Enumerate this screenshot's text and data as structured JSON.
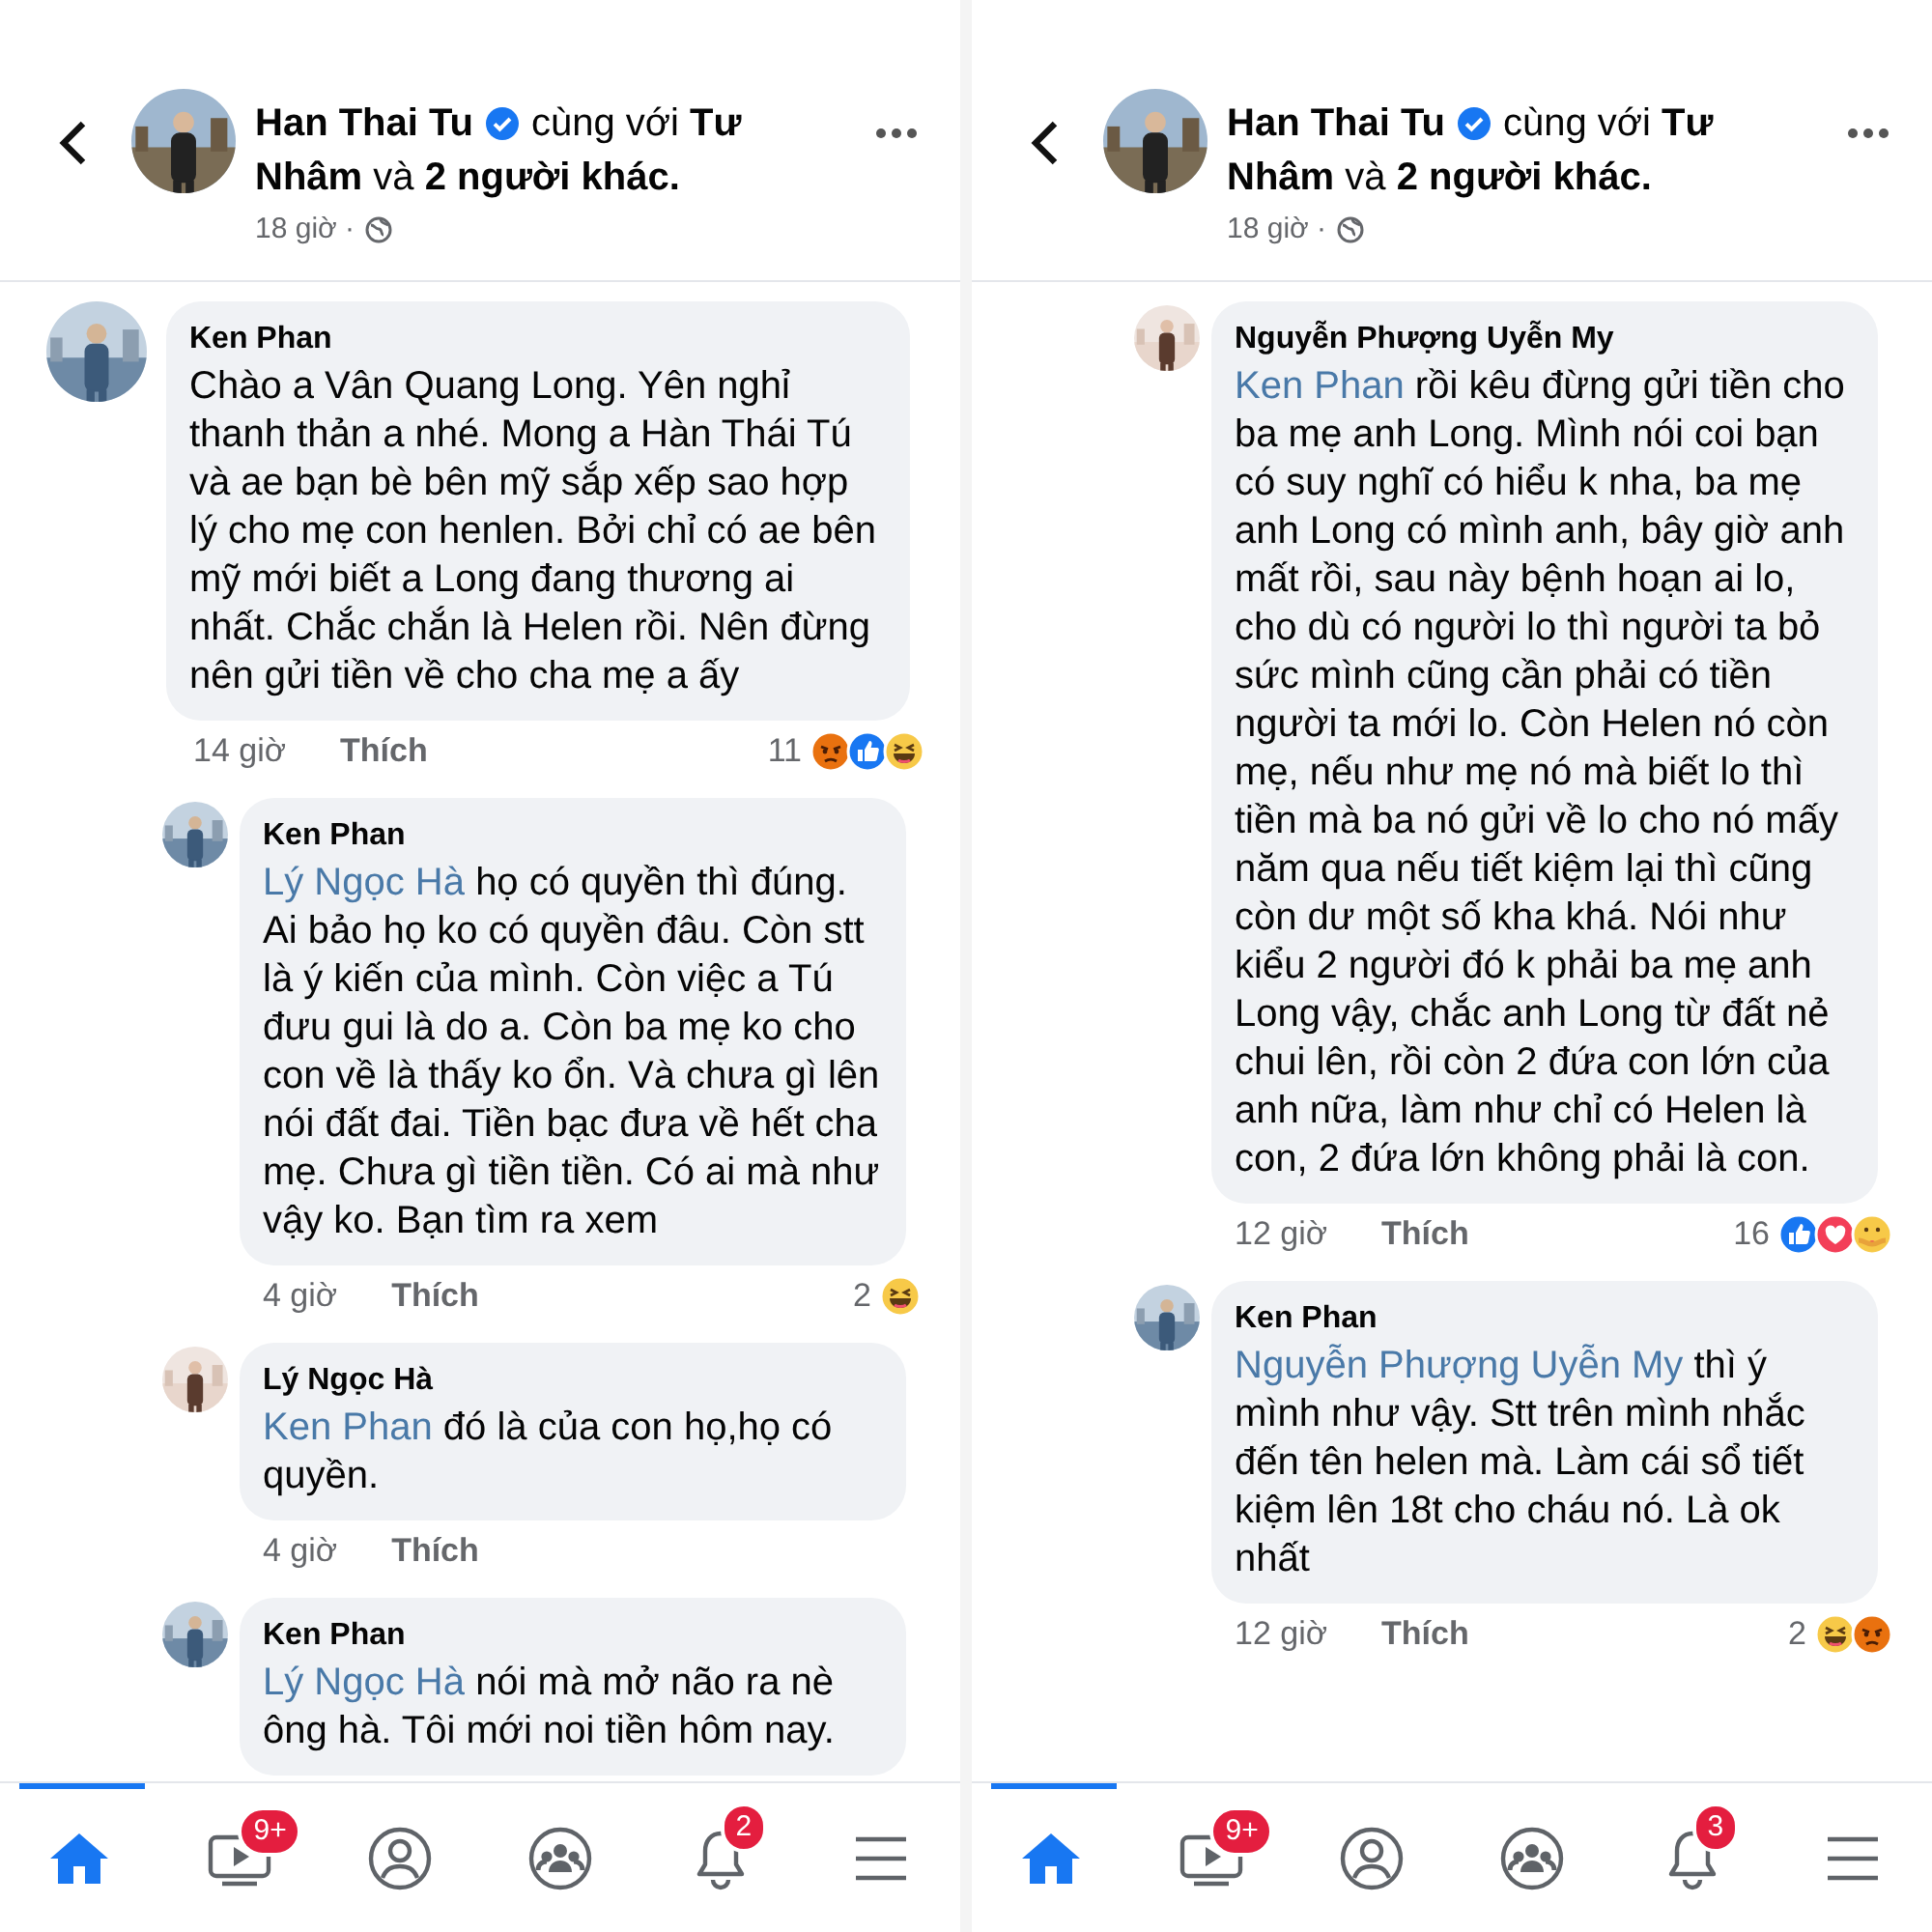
{
  "panels": [
    {
      "post": {
        "author": "Han Thai Tu",
        "verified": true,
        "with_lines": [
          "cùng với **Tư**",
          "**Nhâm** và **2 người khác.**"
        ],
        "time": "18 giờ ·"
      },
      "comments": [
        {
          "kind": "top",
          "author": "Ken Phan",
          "text": "Chào a Vân Quang Long. Yên nghỉ thanh thản a nhé. Mong a Hàn Thái Tú và ae bạn bè bên mỹ sắp xếp sao hợp lý cho mẹ con henlen. Bởi chỉ có ae bên mỹ mới biết a Long đang thương ai nhất. Chắc chắn là Helen rồi. Nên đừng nên gửi tiền về cho cha mẹ a ấy",
          "time": "14 giờ",
          "like": "Thích",
          "reactions": {
            "count": "11",
            "icons": [
              {
                "kind": "angry"
              },
              {
                "kind": "like"
              },
              {
                "kind": "haha"
              }
            ]
          }
        },
        {
          "kind": "reply",
          "author": "Ken Phan",
          "mention": "Lý Ngọc Hà",
          "text": "họ có quyền thì đúng. Ai bảo họ ko có quyền đâu. Còn stt là ý kiến của mình. Còn việc a Tú đưu gui là do a. Còn ba mẹ ko cho con về là thấy ko ổn. Và chưa gì lên nói đất đai. Tiền bạc đưa về hết cha mẹ. Chưa gì tiền tiền. Có ai mà như vậy ko. Bạn tìm ra xem",
          "time": "4 giờ",
          "like": "Thích",
          "reactions": {
            "count": "2",
            "icons": [
              {
                "kind": "haha"
              }
            ]
          }
        },
        {
          "kind": "reply",
          "author": "Lý Ngọc Hà",
          "mention": "Ken Phan",
          "text": " đó là của con họ,họ có quyền.",
          "time": "4 giờ",
          "like": "Thích"
        },
        {
          "kind": "reply",
          "author": "Ken Phan",
          "mention": "Lý Ngọc Hà",
          "text": "nói mà mở não ra nè ông hà. Tôi mới noi tiền hôm nay."
        }
      ],
      "nav": [
        {
          "kind": "home",
          "selected": true
        },
        {
          "kind": "watch",
          "badge": "9+",
          "selected": false
        },
        {
          "kind": "profile",
          "selected": false
        },
        {
          "kind": "groups",
          "selected": false
        },
        {
          "kind": "bell",
          "badge": "2",
          "selected": false
        },
        {
          "kind": "menu",
          "selected": false
        }
      ]
    },
    {
      "post": {
        "author": "Han Thai Tu",
        "verified": true,
        "with_lines": [
          "cùng với **Tư**",
          "**Nhâm** và **2 người khác.**"
        ],
        "time": "18 giờ ·"
      },
      "comments": [
        {
          "kind": "reply",
          "author": "Nguyễn Phượng Uyễn My",
          "mention": "Ken Phan",
          "text": "rồi kêu đừng gửi tiền cho ba mẹ anh Long. Mình nói coi bạn có suy nghĩ có hiểu k nha, ba mẹ anh Long có mình anh, bây giờ anh mất rồi, sau này bệnh hoạn ai lo, cho dù có người lo thì người ta bỏ sức mình cũng cần phải có tiền người ta mới lo. Còn Helen nó còn mẹ, nếu như mẹ nó mà biết lo thì tiền mà ba nó gửi về lo cho nó mấy năm qua nếu tiết kiệm lại thì cũng còn dư một số kha khá. Nói như kiểu 2 người đó k phải ba mẹ anh Long vậy, chắc anh Long từ đất nẻ chui lên, rồi còn 2 đứa con lớn của anh nữa, làm như chỉ có Helen là con, 2 đứa lớn không phải là con.",
          "time": "12 giờ",
          "like": "Thích",
          "reactions": {
            "count": "16",
            "icons": [
              {
                "kind": "like"
              },
              {
                "kind": "love"
              },
              {
                "kind": "care"
              }
            ]
          }
        },
        {
          "kind": "reply",
          "author": "Ken Phan",
          "mention": "Nguyễn Phượng Uyễn My",
          "text": "thì ý mình như vậy. Stt trên mình nhắc đến tên helen mà. Làm cái sổ tiết kiệm lên 18t cho cháu nó. Là ok nhất",
          "time": "12 giờ",
          "like": "Thích",
          "reactions": {
            "count": "2",
            "icons": [
              {
                "kind": "haha"
              },
              {
                "kind": "angry"
              }
            ]
          }
        }
      ],
      "nav": [
        {
          "kind": "home",
          "selected": true
        },
        {
          "kind": "watch",
          "badge": "9+",
          "selected": false
        },
        {
          "kind": "profile",
          "selected": false
        },
        {
          "kind": "groups",
          "selected": false
        },
        {
          "kind": "bell",
          "badge": "3",
          "selected": false
        },
        {
          "kind": "menu",
          "selected": false
        }
      ]
    }
  ]
}
